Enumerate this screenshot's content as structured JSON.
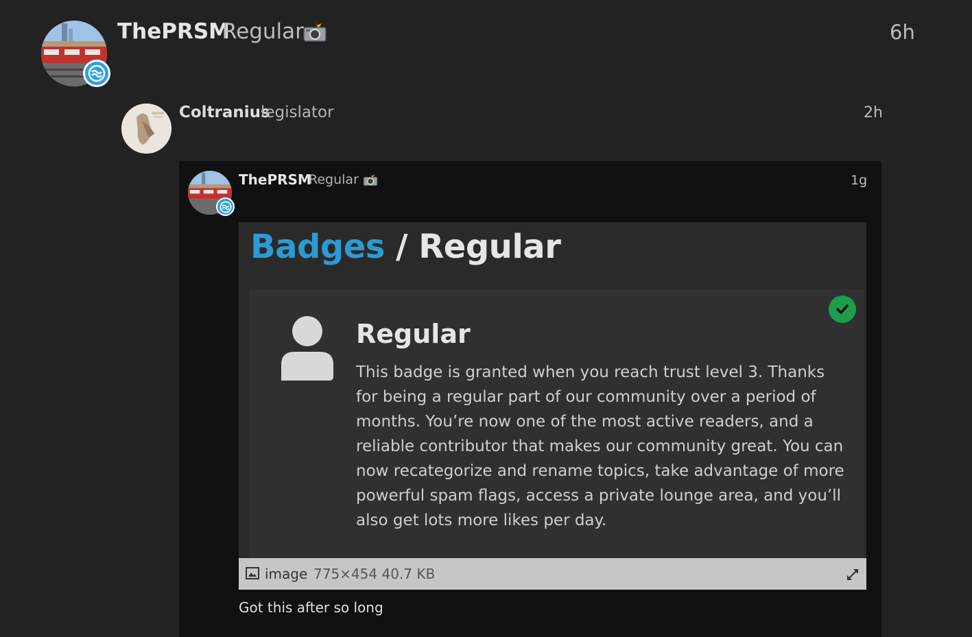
{
  "post": {
    "username": "ThePRSM",
    "user_title": "Regular",
    "flair_icon": "emoji-icon",
    "title_emoji": "camera-flash-icon",
    "time": "6h"
  },
  "reply": {
    "username": "Coltranius",
    "user_title": "legislator",
    "time": "2h"
  },
  "embedded": {
    "username": "ThePRSM",
    "user_title": "Regular",
    "time": "1g",
    "image": {
      "breadcrumb_link": "Badges",
      "breadcrumb_sep": "/",
      "breadcrumb_current": "Regular",
      "badge_name": "Regular",
      "badge_description": "This badge is granted when you reach trust level 3. Thanks for being a regular part of our community over a period of months. You’re now one of the most active readers, and a reliable contributor that makes our community great. You can now recategorize and rename topics, take advantage of more powerful spam flags, access a private lounge area, and you’ll also get lots more likes per day.",
      "granted": true,
      "accent_color": "#2c9ad4",
      "check_color": "#1c9e4a"
    },
    "lightbox": {
      "name": "image",
      "info": "775×454 40.7 KB"
    },
    "caption": "Got this after so long"
  }
}
